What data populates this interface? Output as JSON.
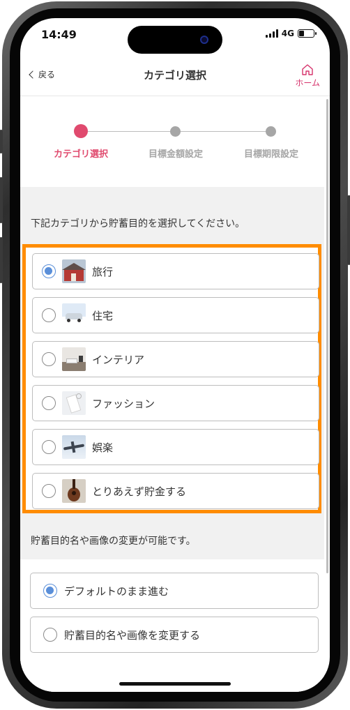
{
  "status": {
    "time": "14:49",
    "network": "4G",
    "battery_level": 0.35
  },
  "nav": {
    "back_label": "戻る",
    "title": "カテゴリ選択",
    "home_label": "ホーム"
  },
  "stepper": {
    "steps": [
      {
        "label": "カテゴリ選択",
        "active": true
      },
      {
        "label": "目標金額設定",
        "active": false
      },
      {
        "label": "目標期限設定",
        "active": false
      }
    ],
    "active_color": "#e04a6e",
    "inactive_color": "#a6a6a6"
  },
  "instruction": "下記カテゴリから貯蓄目的を選択してください。",
  "categories": [
    {
      "label": "旅行",
      "checked": true,
      "icon": "house-photo-icon"
    },
    {
      "label": "住宅",
      "checked": false,
      "icon": "car-photo-icon"
    },
    {
      "label": "インテリア",
      "checked": false,
      "icon": "interior-photo-icon"
    },
    {
      "label": "ファッション",
      "checked": false,
      "icon": "fashion-photo-icon"
    },
    {
      "label": "娯楽",
      "checked": false,
      "icon": "airplane-photo-icon"
    },
    {
      "label": "とりあえず貯金する",
      "checked": false,
      "icon": "guitar-photo-icon"
    }
  ],
  "second_instruction": "貯蓄目的名や画像の変更が可能です。",
  "name_options": [
    {
      "label": "デフォルトのまま進む",
      "checked": true
    },
    {
      "label": "貯蓄目的名や画像を変更する",
      "checked": false
    }
  ],
  "colors": {
    "accent": "#e04a6e",
    "highlight": "#ff8c00",
    "radio_checked": "#5a8fd9"
  }
}
